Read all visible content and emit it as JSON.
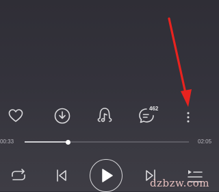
{
  "actions": {
    "comment_count": "462"
  },
  "progress": {
    "elapsed": "00:33",
    "total": "02:05",
    "fraction": 0.264
  },
  "annotation": {
    "arrow_color": "#e8231f"
  },
  "watermark": "dzbzw.com"
}
